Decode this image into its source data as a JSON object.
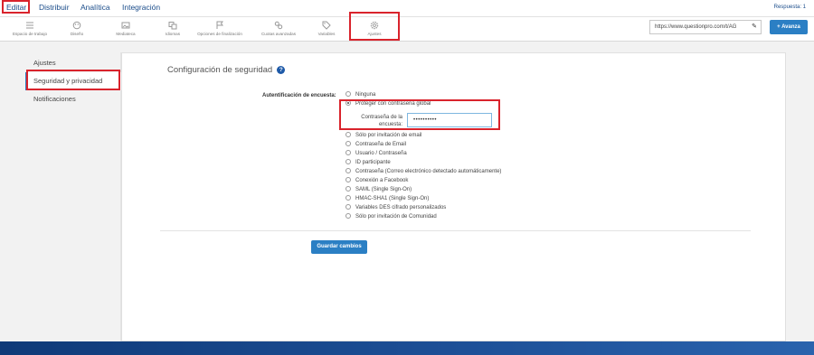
{
  "nav": {
    "tabs": [
      "Editar",
      "Distribuir",
      "Analítica",
      "Integración"
    ],
    "respuestas": "Respuesta: 1"
  },
  "toolbar": {
    "items": [
      {
        "label": "Espacio de trabajo",
        "icon": "workspace-icon"
      },
      {
        "label": "Diseño",
        "icon": "palette-icon"
      },
      {
        "label": "Mediateca",
        "icon": "image-icon"
      },
      {
        "label": "Idiomas",
        "icon": "translate-icon"
      },
      {
        "label": "Opciones de finalización",
        "icon": "flag-icon"
      },
      {
        "label": "Cuotas avanzadas",
        "icon": "link-icon"
      },
      {
        "label": "Variables",
        "icon": "tag-icon"
      },
      {
        "label": "Ajustes",
        "icon": "gear-icon"
      }
    ],
    "url": "https://www.questionpro.com/t/AG",
    "avanza_label": "+ Avanza"
  },
  "sidebar": {
    "items": [
      {
        "label": "Ajustes"
      },
      {
        "label": "Seguridad y privacidad"
      },
      {
        "label": "Notificaciones"
      }
    ]
  },
  "main": {
    "title": "Configuración de seguridad",
    "help": "?",
    "auth_label": "Autentificación de encuesta:",
    "options": [
      {
        "label": "Ninguna",
        "selected": false
      },
      {
        "label": "Proteger con contraseña global",
        "selected": true
      },
      {
        "label": "Sólo por invitación de email",
        "selected": false
      },
      {
        "label": "Contraseña de Email",
        "selected": false
      },
      {
        "label": "Usuario / Contraseña",
        "selected": false
      },
      {
        "label": "ID participante",
        "selected": false
      },
      {
        "label": "Contraseña (Correo electrónico detectado automáticamente)",
        "selected": false
      },
      {
        "label": "Conexión a Facebook",
        "selected": false
      },
      {
        "label": "SAML (Single Sign-On)",
        "selected": false
      },
      {
        "label": "HMAC-SHA1 (Single Sign-On)",
        "selected": false
      },
      {
        "label": "Variables DES cifrado personalizados",
        "selected": false
      },
      {
        "label": "Sólo por invitación de Comunidad",
        "selected": false
      }
    ],
    "password_label_line1": "Contraseña de la",
    "password_label_line2": "encuesta:",
    "password_value": "••••••••••",
    "save_label": "Guardar cambios"
  },
  "colors": {
    "accent": "#2b7fc4",
    "highlight_box": "#d9232c",
    "nav_text": "#1a4c8a",
    "bottom_band": "#1d4f96"
  }
}
